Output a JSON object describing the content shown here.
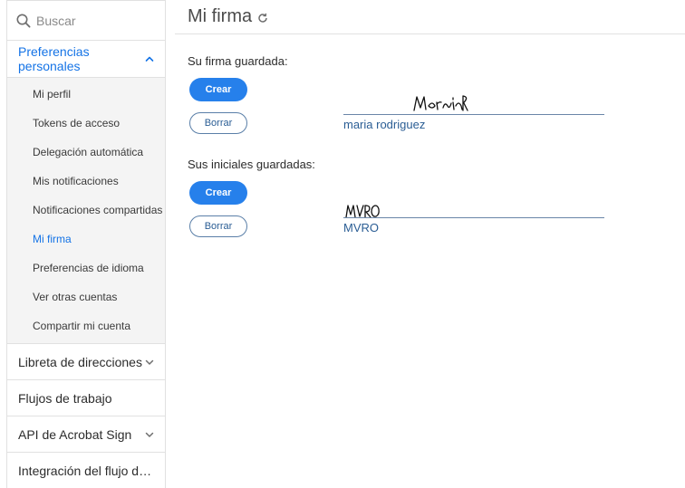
{
  "search": {
    "placeholder": "Buscar"
  },
  "sidebar": {
    "personal": {
      "label": "Preferencias personales",
      "items": [
        {
          "label": "Mi perfil"
        },
        {
          "label": "Tokens de acceso"
        },
        {
          "label": "Delegación automática"
        },
        {
          "label": "Mis notificaciones"
        },
        {
          "label": "Notificaciones compartidas"
        },
        {
          "label": "Mi firma"
        },
        {
          "label": "Preferencias de idioma"
        },
        {
          "label": "Ver otras cuentas"
        },
        {
          "label": "Compartir mi cuenta"
        }
      ]
    },
    "sections": [
      {
        "label": "Libreta de direcciones"
      },
      {
        "label": "Flujos de trabajo"
      },
      {
        "label": "API de Acrobat Sign"
      },
      {
        "label": "Integración del flujo de tra..."
      }
    ]
  },
  "main": {
    "title": "Mi firma",
    "signature": {
      "label": "Su firma guardada:",
      "create": "Crear",
      "clear": "Borrar",
      "handwritten": "MariaR",
      "name": "maria rodriguez"
    },
    "initials": {
      "label": "Sus iniciales guardadas:",
      "create": "Crear",
      "clear": "Borrar",
      "handwritten": "MVRO",
      "name": "MVRO"
    }
  },
  "colors": {
    "accent": "#1473e6",
    "button": "#2680eb",
    "link": "#2a5d94"
  }
}
